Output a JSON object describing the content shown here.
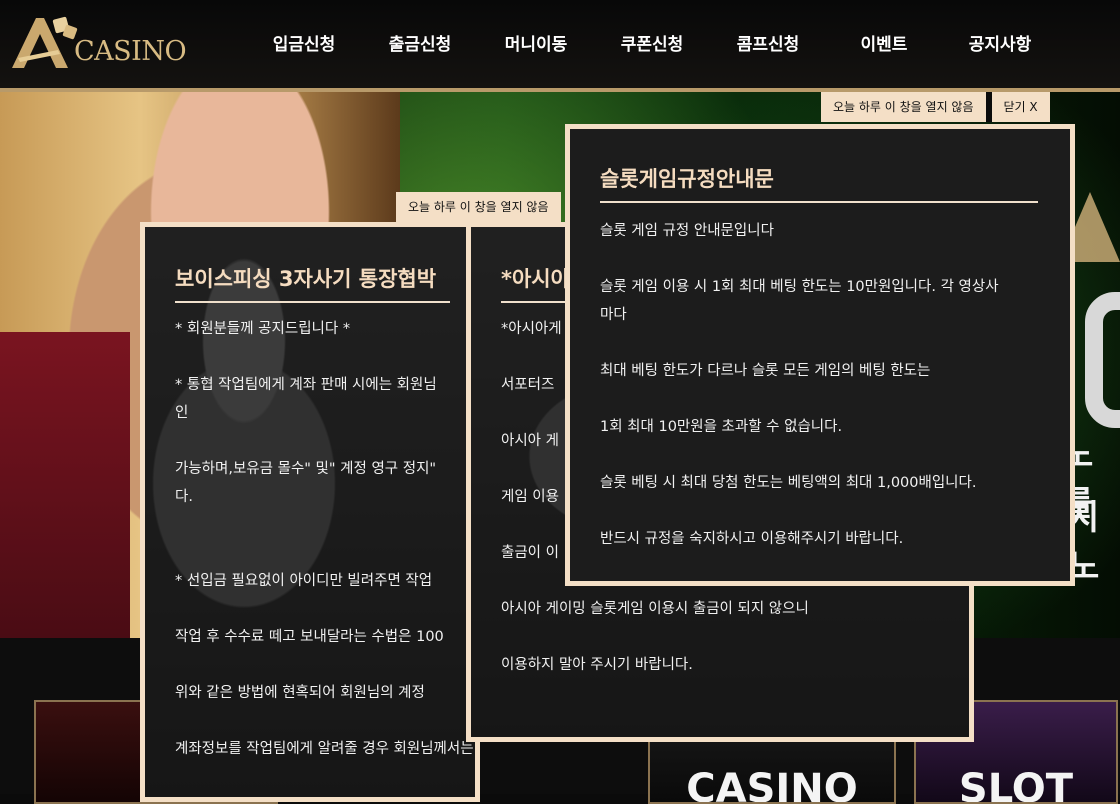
{
  "logo": {
    "text": "CASINO",
    "brand_color": "#d8bb83"
  },
  "nav": {
    "items": [
      "입금신청",
      "출금신청",
      "머니이동",
      "쿠폰신청",
      "콤프신청",
      "이벤트",
      "공지사항"
    ]
  },
  "hero": {
    "text_line1": "노를",
    "text_line2": "지노"
  },
  "tiles": {
    "casino_label": "CASINO",
    "slot_label": "SLOT"
  },
  "popup_controls": {
    "no_show_today": "오늘 하루 이 창을 열지 않음",
    "close": "닫기 X"
  },
  "popups": [
    {
      "title": "보이스피싱 3자사기 통장협박",
      "lines": [
        "* 회원분들께 공지드립니다 *",
        "",
        "* 통협 작업팀에게 계좌 판매 시에는 회원님",
        "인",
        "",
        "가능하며,보유금 몰수\" 및\" 계정 영구 정지\" ",
        "다.",
        "",
        "",
        "* 선입금 필요없이 아이디만 빌려주면 작업",
        "",
        "작업 후 수수료 떼고 보내달라는 수법은 100",
        "",
        "위와 같은 방법에 현혹되어 회원님의 계정 ",
        "",
        "계좌정보를 작업팀에게 알려줄 경우 회원님께서는 약속된"
      ]
    },
    {
      "title": "*아시아",
      "lines": [
        "*아시아게",
        "",
        "서포터즈",
        "",
        "아시아 게",
        "",
        "게임 이용",
        "",
        "출금이 이",
        "",
        "아시아 게이밍 슬롯게임 이용시 출금이 되지 않으니",
        "",
        "이용하지 말아 주시기 바랍니다."
      ]
    },
    {
      "title": "슬롯게임규정안내문",
      "lines": [
        "슬롯 게임 규정 안내문입니다",
        "",
        "슬롯 게임 이용 시 1회 최대 베팅 한도는 10만원입니다. 각 영상사",
        "마다",
        "",
        "최대 베팅 한도가 다르나 슬롯 모든 게임의 베팅 한도는",
        "",
        "1회 최대 10만원을 초과할 수 없습니다.",
        "",
        "슬롯 베팅 시 최대 당첨 한도는 베팅액의 최대 1,000배입니다.",
        "",
        "반드시 규정을 숙지하시고 이용해주시기 바랍니다."
      ]
    }
  ],
  "colors": {
    "popup_border": "#f4dfc6",
    "popup_title": "#f5dcc0",
    "header_accent": "#b89a6a"
  }
}
